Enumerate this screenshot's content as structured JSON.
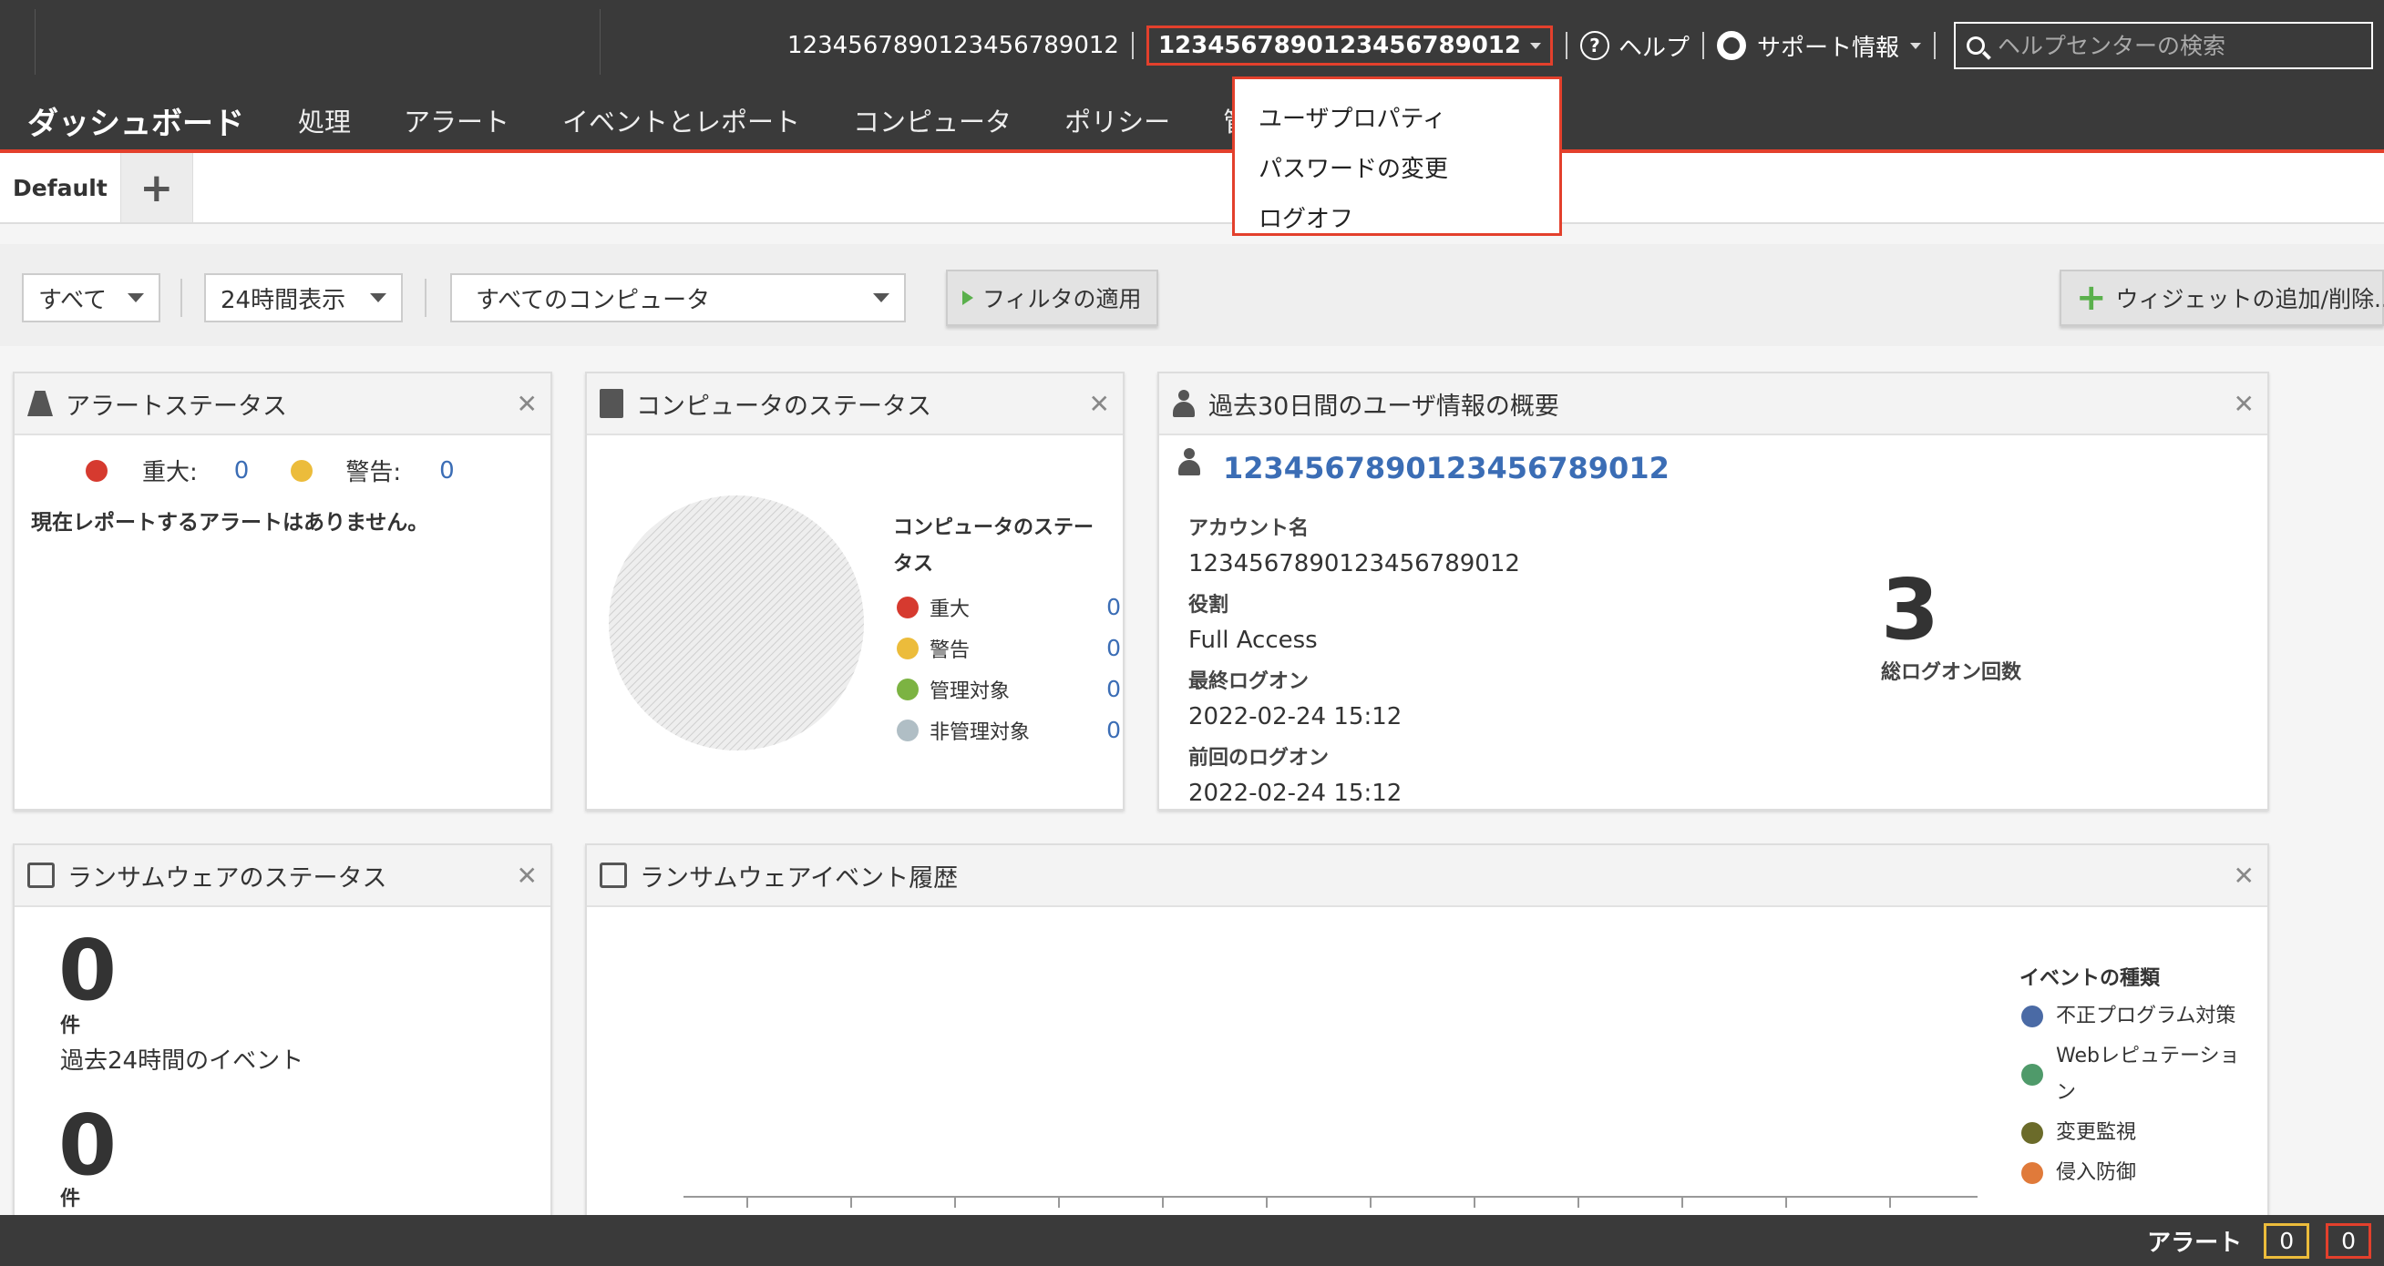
{
  "topbar": {
    "user_plain": "1234567890123456789012",
    "user_active": "1234567890123456789012",
    "help": "ヘルプ",
    "support": "サポート情報",
    "search_placeholder": "ヘルプセンターの検索"
  },
  "nav": {
    "brand": "ダッシュボード",
    "items": [
      "処理",
      "アラート",
      "イベントとレポート",
      "コンピュータ",
      "ポリシー",
      "管理"
    ]
  },
  "dropdown": {
    "items": [
      "ユーザプロパティ",
      "パスワードの変更",
      "ログオフ"
    ]
  },
  "tabs": {
    "default": "Default",
    "add": "+"
  },
  "filters": {
    "severity": "すべて",
    "period": "24時間表示",
    "computers": "すべてのコンピュータ",
    "apply": "フィルタの適用",
    "add_widget": "ウィジェットの追加/削除..."
  },
  "alert_status": {
    "title": "アラートステータス",
    "critical_label": "重大:",
    "critical_value": "0",
    "warning_label": "警告:",
    "warning_value": "0",
    "message": "現在レポートするアラートはありません。"
  },
  "computer_status": {
    "title": "コンピュータのステータス",
    "legend_title": "コンピュータのステータス",
    "rows": [
      {
        "label": "重大",
        "value": "0",
        "color": "#d63a2f"
      },
      {
        "label": "警告",
        "value": "0",
        "color": "#ecbc3b"
      },
      {
        "label": "管理対象",
        "value": "0",
        "color": "#7cb342"
      },
      {
        "label": "非管理対象",
        "value": "0",
        "color": "#b0bec5"
      }
    ]
  },
  "user_summary": {
    "title": "過去30日間のユーザ情報の概要",
    "username": "1234567890123456789012",
    "account_label": "アカウント名",
    "account_value": "1234567890123456789012",
    "role_label": "役割",
    "role_value": "Full Access",
    "last_logon_label": "最終ログオン",
    "last_logon_value": "2022-02-24 15:12",
    "prev_logon_label": "前回のログオン",
    "prev_logon_value": "2022-02-24 15:12",
    "logon_count": "3",
    "logon_count_label": "総ログオン回数"
  },
  "ransom_status": {
    "title": "ランサムウェアのステータス",
    "count1": "0",
    "unit1": "件",
    "desc1": "過去24時間のイベント",
    "count2": "0",
    "unit2": "件"
  },
  "ransom_history": {
    "title": "ランサムウェアイベント履歴",
    "legend_title": "イベントの種類",
    "legend": [
      {
        "label": "不正プログラム対策",
        "color": "#4a6aa5"
      },
      {
        "label": "Webレピュテーション",
        "color": "#4f9a6a"
      },
      {
        "label": "変更監視",
        "color": "#6b6b2a"
      },
      {
        "label": "侵入防御",
        "color": "#e07a3a"
      }
    ]
  },
  "footer": {
    "alert_label": "アラート",
    "count_warning": "0",
    "count_critical": "0"
  },
  "colors": {
    "accent": "#e3402c",
    "topbar": "#3a3a3a",
    "link": "#3b6db5"
  }
}
